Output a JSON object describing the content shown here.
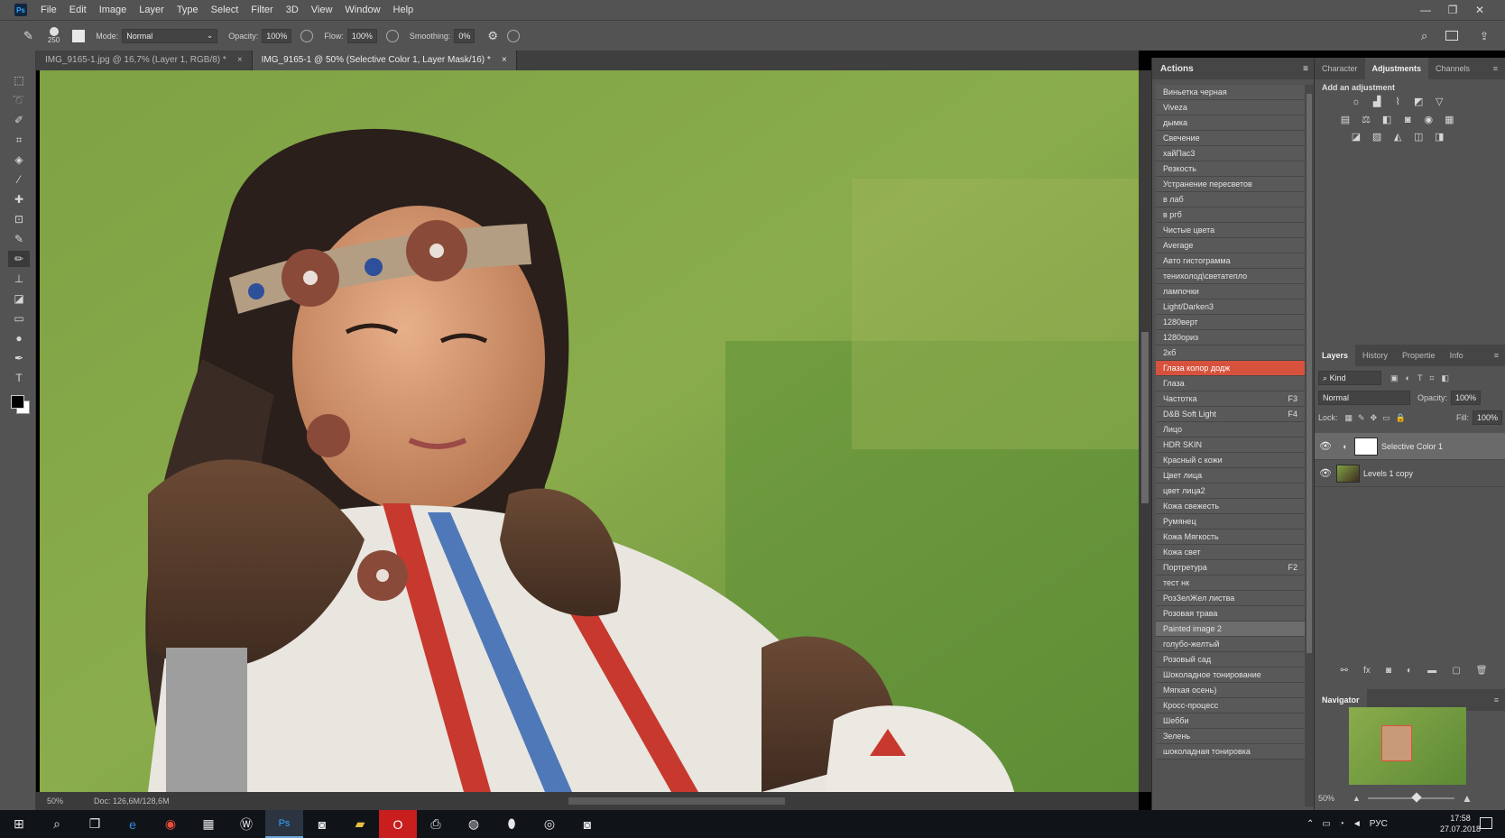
{
  "app": {
    "logo": "Ps"
  },
  "menu": [
    "File",
    "Edit",
    "Image",
    "Layer",
    "Type",
    "Select",
    "Filter",
    "3D",
    "View",
    "Window",
    "Help"
  ],
  "window_controls": {
    "minimize": "—",
    "restore": "❐",
    "close": "✕"
  },
  "options": {
    "brush_size": "250",
    "mode_label": "Mode:",
    "mode_value": "Normal",
    "opacity_label": "Opacity:",
    "opacity_value": "100%",
    "flow_label": "Flow:",
    "flow_value": "100%",
    "smoothing_label": "Smoothing:",
    "smoothing_value": "0%"
  },
  "tabs": [
    {
      "label": "IMG_9165-1.jpg @ 16,7% (Layer 1, RGB/8) *",
      "close": "×"
    },
    {
      "label": "IMG_9165-1 @ 50% (Selective Color 1, Layer Mask/16) *",
      "close": "×"
    }
  ],
  "status": {
    "zoom": "50%",
    "doc": "Doc: 126,6M/128,6M"
  },
  "actions": {
    "title": "Actions",
    "items": [
      {
        "label": "Виньетка черная",
        "key": ""
      },
      {
        "label": "Viveza",
        "key": ""
      },
      {
        "label": "дымка",
        "key": ""
      },
      {
        "label": "Свечение",
        "key": ""
      },
      {
        "label": "хайПас3",
        "key": ""
      },
      {
        "label": "Резкость",
        "key": ""
      },
      {
        "label": "Устранение пересветов",
        "key": ""
      },
      {
        "label": "в лаб",
        "key": ""
      },
      {
        "label": "в ргб",
        "key": ""
      },
      {
        "label": "Чистые цвета",
        "key": ""
      },
      {
        "label": "Average",
        "key": ""
      },
      {
        "label": "Авто гистограмма",
        "key": ""
      },
      {
        "label": "тенихолод\\светатепло",
        "key": ""
      },
      {
        "label": "лампочки",
        "key": ""
      },
      {
        "label": "Light/Darken3",
        "key": ""
      },
      {
        "label": "1280верт",
        "key": ""
      },
      {
        "label": "1280ориз",
        "key": ""
      },
      {
        "label": "2кб",
        "key": ""
      },
      {
        "label": "Глаза колор додж",
        "key": ""
      },
      {
        "label": "Глаза",
        "key": ""
      },
      {
        "label": "Частотка",
        "key": "F3"
      },
      {
        "label": "D&B Soft Light",
        "key": "F4"
      },
      {
        "label": "Лицо",
        "key": ""
      },
      {
        "label": "HDR SKIN",
        "key": ""
      },
      {
        "label": "Красный с кожи",
        "key": ""
      },
      {
        "label": "Цвет лица",
        "key": ""
      },
      {
        "label": "цвет лица2",
        "key": ""
      },
      {
        "label": "Кожа свежесть",
        "key": ""
      },
      {
        "label": "Румянец",
        "key": ""
      },
      {
        "label": "Кожа Мягкость",
        "key": ""
      },
      {
        "label": "Кожа свет",
        "key": ""
      },
      {
        "label": "Портретура",
        "key": "F2"
      },
      {
        "label": "тест нк",
        "key": ""
      },
      {
        "label": "РозЗелЖел листва",
        "key": ""
      },
      {
        "label": "Розовая трава",
        "key": ""
      },
      {
        "label": "Painted image 2",
        "key": ""
      },
      {
        "label": "голубо-желтый",
        "key": ""
      },
      {
        "label": "Розовый сад",
        "key": ""
      },
      {
        "label": "Шоколадное тонирование",
        "key": ""
      },
      {
        "label": "Мягкая осень)",
        "key": ""
      },
      {
        "label": "Кросс-процесс",
        "key": ""
      },
      {
        "label": "Шебби",
        "key": ""
      },
      {
        "label": "Зелень",
        "key": ""
      },
      {
        "label": "шоколадная тонировка",
        "key": ""
      }
    ],
    "selected_index": 18,
    "highlight_index": 35
  },
  "panels_top": {
    "tabs": [
      "Character",
      "Adjustments",
      "Channels"
    ],
    "active": "Adjustments",
    "add_label": "Add an adjustment"
  },
  "layers_panel": {
    "tabs": [
      "Layers",
      "History",
      "Propertie",
      "Info"
    ],
    "kind": "Kind",
    "blend": "Normal",
    "opacity_label": "Opacity:",
    "opacity": "100%",
    "lock_label": "Lock:",
    "fill_label": "Fill:",
    "fill": "100%",
    "layers": [
      {
        "name": "Selective Color 1",
        "selected": true
      },
      {
        "name": "Levels 1 copy",
        "selected": false
      }
    ]
  },
  "navigator": {
    "title": "Navigator",
    "zoom": "50%"
  },
  "taskbar": {
    "lang": "РУС",
    "time": "17:58",
    "date": "27.07.2018"
  },
  "colors": {
    "accent_selected": "#d6523d",
    "panel": "#535353",
    "taskbar": "#101418"
  }
}
